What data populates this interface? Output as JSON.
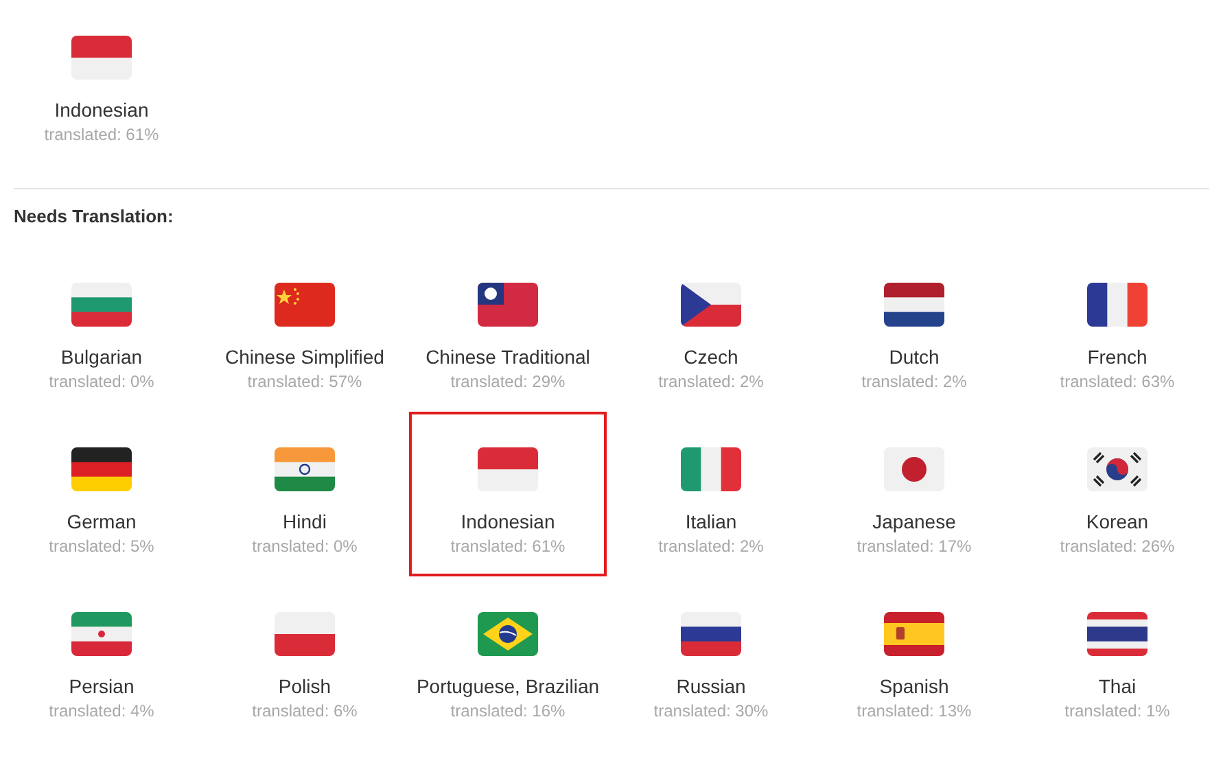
{
  "completed": [
    {
      "kind": "indonesia",
      "name": "Indonesian",
      "progress": "translated: 61%",
      "selected": false
    }
  ],
  "needs_translation": {
    "heading": "Needs Translation:",
    "languages": [
      {
        "kind": "bulgaria",
        "name": "Bulgarian",
        "progress": "translated: 0%",
        "selected": false
      },
      {
        "kind": "china",
        "name": "Chinese Simplified",
        "progress": "translated: 57%",
        "selected": false
      },
      {
        "kind": "taiwan",
        "name": "Chinese Traditional",
        "progress": "translated: 29%",
        "selected": false
      },
      {
        "kind": "czech",
        "name": "Czech",
        "progress": "translated: 2%",
        "selected": false
      },
      {
        "kind": "netherlands",
        "name": "Dutch",
        "progress": "translated: 2%",
        "selected": false
      },
      {
        "kind": "france",
        "name": "French",
        "progress": "translated: 63%",
        "selected": false
      },
      {
        "kind": "germany",
        "name": "German",
        "progress": "translated: 5%",
        "selected": false
      },
      {
        "kind": "india",
        "name": "Hindi",
        "progress": "translated: 0%",
        "selected": false
      },
      {
        "kind": "indonesia",
        "name": "Indonesian",
        "progress": "translated: 61%",
        "selected": true
      },
      {
        "kind": "italy",
        "name": "Italian",
        "progress": "translated: 2%",
        "selected": false
      },
      {
        "kind": "japan",
        "name": "Japanese",
        "progress": "translated: 17%",
        "selected": false
      },
      {
        "kind": "korea",
        "name": "Korean",
        "progress": "translated: 26%",
        "selected": false
      },
      {
        "kind": "iran",
        "name": "Persian",
        "progress": "translated: 4%",
        "selected": false
      },
      {
        "kind": "poland",
        "name": "Polish",
        "progress": "translated: 6%",
        "selected": false
      },
      {
        "kind": "brazil",
        "name": "Portuguese, Brazilian",
        "progress": "translated: 16%",
        "selected": false
      },
      {
        "kind": "russia",
        "name": "Russian",
        "progress": "translated: 30%",
        "selected": false
      },
      {
        "kind": "spain",
        "name": "Spanish",
        "progress": "translated: 13%",
        "selected": false
      },
      {
        "kind": "thailand",
        "name": "Thai",
        "progress": "translated: 1%",
        "selected": false
      }
    ]
  }
}
